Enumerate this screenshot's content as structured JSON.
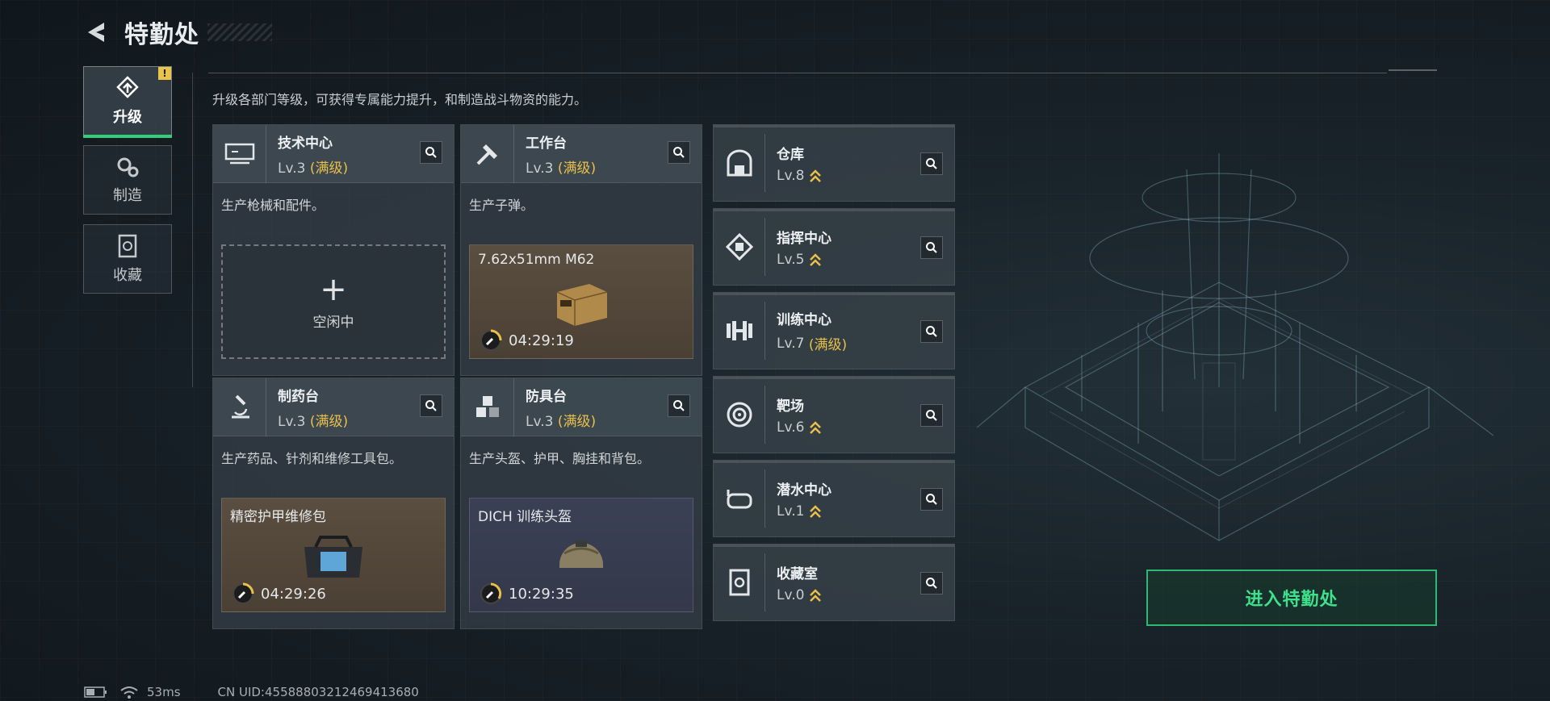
{
  "header": {
    "title": "特勤处"
  },
  "nav": {
    "items": [
      {
        "label": "升级",
        "active": true,
        "badge": "!"
      },
      {
        "label": "制造",
        "active": false
      },
      {
        "label": "收藏",
        "active": false
      }
    ]
  },
  "subtitle": "升级各部门等级，可获得专属能力提升，和制造战斗物资的能力。",
  "workshops": [
    {
      "name": "技术中心",
      "level": "Lv.3",
      "max": "(满级)",
      "desc": "生产枪械和配件。",
      "slot": {
        "state": "idle",
        "plus": "+",
        "label": "空闲中"
      }
    },
    {
      "name": "工作台",
      "level": "Lv.3",
      "max": "(满级)",
      "desc": "生产子弹。",
      "slot": {
        "state": "producing",
        "item": "7.62x51mm M62",
        "timer": "04:29:19"
      }
    },
    {
      "name": "制药台",
      "level": "Lv.3",
      "max": "(满级)",
      "desc": "生产药品、针剂和维修工具包。",
      "slot": {
        "state": "producing",
        "item": "精密护甲维修包",
        "timer": "04:29:26"
      }
    },
    {
      "name": "防具台",
      "level": "Lv.3",
      "max": "(满级)",
      "desc": "生产头盔、护甲、胸挂和背包。",
      "slot": {
        "state": "producing",
        "item": "DICH 训练头盔",
        "timer": "10:29:35"
      }
    }
  ],
  "facilities": [
    {
      "name": "仓库",
      "level": "Lv.8",
      "max": "",
      "upgradable": true
    },
    {
      "name": "指挥中心",
      "level": "Lv.5",
      "max": "",
      "upgradable": true
    },
    {
      "name": "训练中心",
      "level": "Lv.7",
      "max": "(满级)",
      "upgradable": false
    },
    {
      "name": "靶场",
      "level": "Lv.6",
      "max": "",
      "upgradable": true
    },
    {
      "name": "潜水中心",
      "level": "Lv.1",
      "max": "",
      "upgradable": true
    },
    {
      "name": "收藏室",
      "level": "Lv.0",
      "max": "",
      "upgradable": true
    }
  ],
  "enter_button": "进入特勤处",
  "status": {
    "ping": "53ms",
    "uid": "CN UID:455888032124694136​80"
  },
  "colors": {
    "accent_green": "#2fb871",
    "max_level_gold": "#e8c04a",
    "badge_yellow": "#e9c44a"
  }
}
